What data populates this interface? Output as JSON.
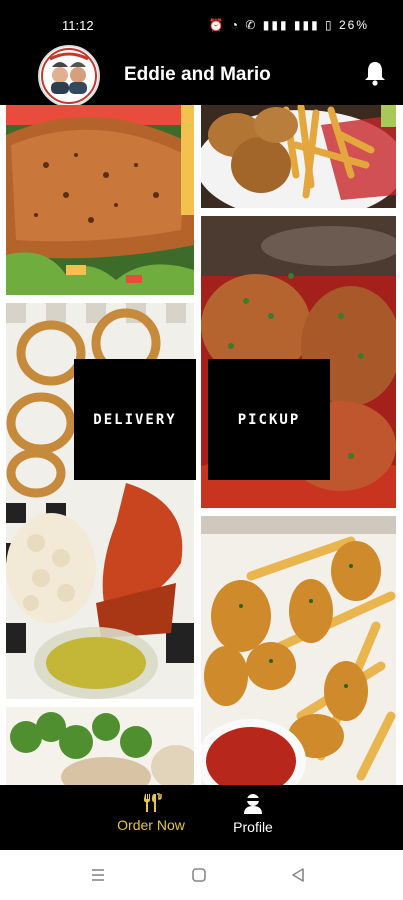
{
  "status_bar": {
    "time": "11:12",
    "battery": "26%"
  },
  "header": {
    "title": "Eddie and Mario",
    "logo": "restaurant-logo",
    "bell_icon": "bell-icon"
  },
  "actions": {
    "delivery": "DELIVERY",
    "pickup": "PICKUP"
  },
  "bottom_nav": {
    "order_now": "Order Now",
    "profile": "Profile",
    "accent_color": "#e8c547"
  },
  "tiles": [
    "grilled-salmon-salad",
    "chicken-wings-and-fries",
    "onion-rings-and-lobster",
    "meatballs-in-sauce",
    "potato-salad-and-butter-cup",
    "chicken-nuggets-and-fries",
    "broccoli-and-lobster-plate"
  ]
}
